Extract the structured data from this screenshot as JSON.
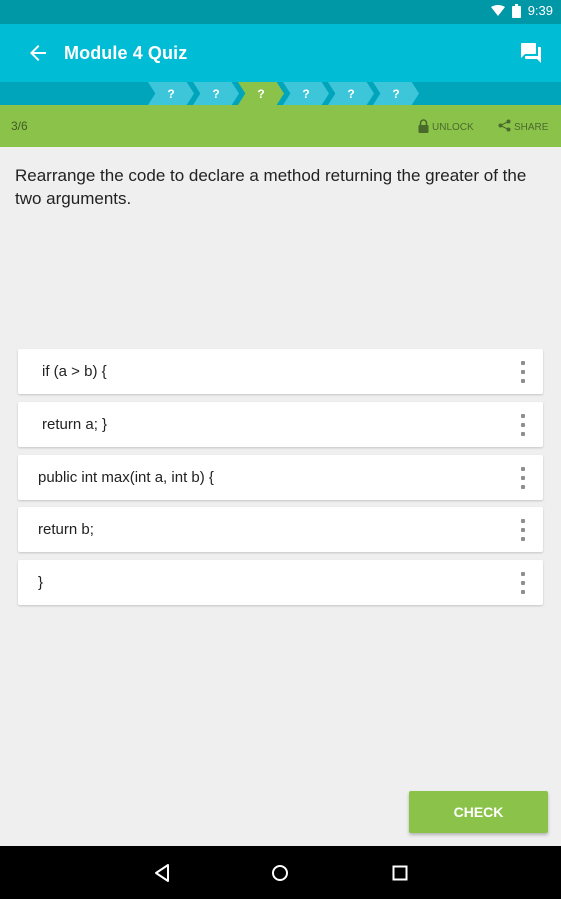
{
  "status_bar": {
    "time": "9:39"
  },
  "app_bar": {
    "title": "Module 4 Quiz"
  },
  "progress": {
    "steps": [
      "?",
      "?",
      "?",
      "?",
      "?",
      "?"
    ],
    "active_index": 2
  },
  "quiz_bar": {
    "counter": "3/6",
    "unlock_label": "UNLOCK",
    "share_label": "SHARE"
  },
  "question": "Rearrange the code to declare a method returning the greater of the two arguments.",
  "code_lines": [
    "if (a > b) {",
    "return a; }",
    "public int max(int a, int b) {",
    "return b;",
    "}"
  ],
  "check_label": "CHECK",
  "colors": {
    "primary": "#00bcd4",
    "primary_dark": "#0097a7",
    "accent_green": "#8bc34a"
  }
}
